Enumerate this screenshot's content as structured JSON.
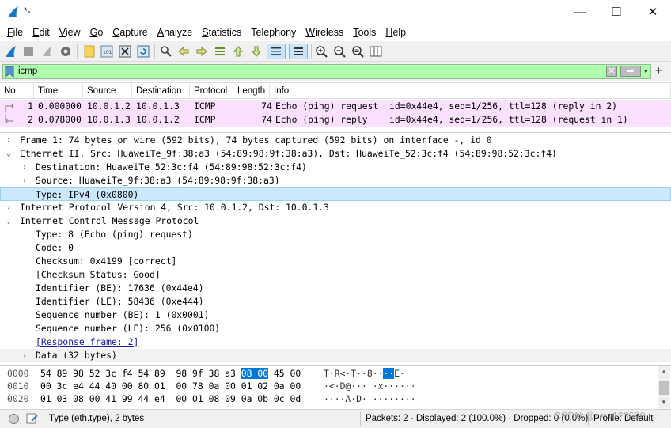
{
  "window": {
    "title": "*-",
    "controls": {
      "minimize": "—",
      "maximize": "☐",
      "close": "✕"
    }
  },
  "menu": [
    {
      "label": "File",
      "mnemonic": "F",
      "rest": "ile"
    },
    {
      "label": "Edit",
      "mnemonic": "E",
      "rest": "dit"
    },
    {
      "label": "View",
      "mnemonic": "V",
      "rest": "iew"
    },
    {
      "label": "Go",
      "mnemonic": "G",
      "rest": "o"
    },
    {
      "label": "Capture",
      "mnemonic": "C",
      "rest": "apture"
    },
    {
      "label": "Analyze",
      "mnemonic": "A",
      "rest": "nalyze"
    },
    {
      "label": "Statistics",
      "mnemonic": "S",
      "rest": "tatistics"
    },
    {
      "label": "Telephony",
      "mnemonic": "",
      "rest": "Telephony"
    },
    {
      "label": "Wireless",
      "mnemonic": "W",
      "rest": "ireless"
    },
    {
      "label": "Tools",
      "mnemonic": "T",
      "rest": "ools"
    },
    {
      "label": "Help",
      "mnemonic": "H",
      "rest": "elp"
    }
  ],
  "filter": {
    "value": "icmp",
    "bg_color": "#afffaf",
    "add_label": "+"
  },
  "packet_list": {
    "columns": [
      "No.",
      "Time",
      "Source",
      "Destination",
      "Protocol",
      "Length",
      "Info"
    ],
    "rows": [
      {
        "no": "1",
        "time": "0.000000",
        "source": "10.0.1.2",
        "destination": "10.0.1.3",
        "protocol": "ICMP",
        "length": "74",
        "info": "Echo (ping) request  id=0x44e4, seq=1/256, ttl=128 (reply in 2)"
      },
      {
        "no": "2",
        "time": "0.078000",
        "source": "10.0.1.3",
        "destination": "10.0.1.2",
        "protocol": "ICMP",
        "length": "74",
        "info": "Echo (ping) reply    id=0x44e4, seq=1/256, ttl=128 (request in 1)"
      }
    ],
    "row_color": "#fce0ff"
  },
  "details": [
    {
      "indent": 0,
      "arrow": "›",
      "text": "Frame 1: 74 bytes on wire (592 bits), 74 bytes captured (592 bits) on interface -, id 0"
    },
    {
      "indent": 0,
      "arrow": "⌄",
      "text": "Ethernet II, Src: HuaweiTe_9f:38:a3 (54:89:98:9f:38:a3), Dst: HuaweiTe_52:3c:f4 (54:89:98:52:3c:f4)"
    },
    {
      "indent": 1,
      "arrow": "›",
      "text": "Destination: HuaweiTe_52:3c:f4 (54:89:98:52:3c:f4)"
    },
    {
      "indent": 1,
      "arrow": "›",
      "text": "Source: HuaweiTe_9f:38:a3 (54:89:98:9f:38:a3)"
    },
    {
      "indent": 1,
      "arrow": "",
      "text": "Type: IPv4 (0x0800)",
      "selected": true
    },
    {
      "indent": 0,
      "arrow": "›",
      "text": "Internet Protocol Version 4, Src: 10.0.1.2, Dst: 10.0.1.3"
    },
    {
      "indent": 0,
      "arrow": "⌄",
      "text": "Internet Control Message Protocol"
    },
    {
      "indent": 1,
      "arrow": "",
      "text": "Type: 8 (Echo (ping) request)"
    },
    {
      "indent": 1,
      "arrow": "",
      "text": "Code: 0"
    },
    {
      "indent": 1,
      "arrow": "",
      "text": "Checksum: 0x4199 [correct]"
    },
    {
      "indent": 1,
      "arrow": "",
      "text": "[Checksum Status: Good]"
    },
    {
      "indent": 1,
      "arrow": "",
      "text": "Identifier (BE): 17636 (0x44e4)"
    },
    {
      "indent": 1,
      "arrow": "",
      "text": "Identifier (LE): 58436 (0xe444)"
    },
    {
      "indent": 1,
      "arrow": "",
      "text": "Sequence number (BE): 1 (0x0001)"
    },
    {
      "indent": 1,
      "arrow": "",
      "text": "Sequence number (LE): 256 (0x0100)"
    },
    {
      "indent": 1,
      "arrow": "",
      "text": "[Response frame: 2]",
      "link": true
    },
    {
      "indent": 1,
      "arrow": "›",
      "text": "Data (32 bytes)",
      "alt": true
    }
  ],
  "bytes": [
    {
      "offset": "0000",
      "hex_pre": "54 89 98 52 3c f4 54 89  98 9f 38 a3 ",
      "hex_hl": "08 00",
      "hex_post": " 45 00",
      "ascii_pre": "T·R<·T··8··",
      "ascii_hl": "··",
      "ascii_post": "E·"
    },
    {
      "offset": "0010",
      "hex_pre": "00 3c e4 44 40 00 80 01  00 78 0a 00 01 02 0a 00",
      "hex_hl": "",
      "hex_post": "",
      "ascii_pre": "·<·D@··· ·x······",
      "ascii_hl": "",
      "ascii_post": ""
    },
    {
      "offset": "0020",
      "hex_pre": "01 03 08 00 41 99 44 e4  00 01 08 09 0a 0b 0c 0d",
      "hex_hl": "",
      "hex_post": "",
      "ascii_pre": "····A·D· ········",
      "ascii_hl": "",
      "ascii_post": ""
    }
  ],
  "status": {
    "field_info": "Type (eth.type), 2 bytes",
    "packets": "Packets: 2 · Displayed: 2 (100.0%) · Dropped: 0 (0.0%)",
    "profile": "Profile: Default",
    "watermark": "CSDN @cow123698"
  }
}
